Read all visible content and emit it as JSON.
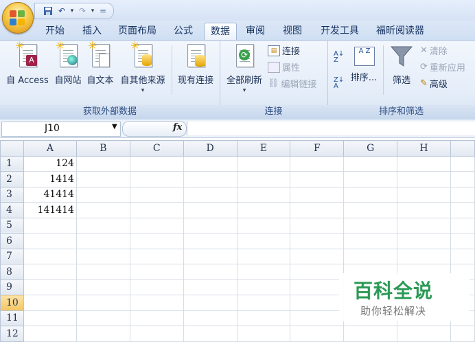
{
  "quick_access": {
    "save": "save-icon",
    "undo": "undo-icon",
    "redo": "redo-icon",
    "customize": "="
  },
  "tabs": [
    {
      "label": "开始"
    },
    {
      "label": "插入"
    },
    {
      "label": "页面布局"
    },
    {
      "label": "公式"
    },
    {
      "label": "数据",
      "active": true
    },
    {
      "label": "审阅"
    },
    {
      "label": "视图"
    },
    {
      "label": "开发工具"
    },
    {
      "label": "福昕阅读器"
    }
  ],
  "ribbon": {
    "external": {
      "label": "获取外部数据",
      "access": "自 Access",
      "web": "自网站",
      "text": "自文本",
      "other": "自其他来源",
      "existing": "现有连接"
    },
    "connections": {
      "label": "连接",
      "refresh_all": "全部刷新",
      "connections": "连接",
      "properties": "属性",
      "edit_links": "编辑链接"
    },
    "sort_filter": {
      "label": "排序和筛选",
      "sort": "排序...",
      "filter": "筛选",
      "clear": "清除",
      "reapply": "重新应用",
      "advanced": "高级",
      "az": "A Z",
      "za": "Z A"
    }
  },
  "formula_bar": {
    "name_box": "J10",
    "fx": "fx",
    "formula": ""
  },
  "sheet": {
    "columns": [
      "A",
      "B",
      "C",
      "D",
      "E",
      "F",
      "G",
      "H"
    ],
    "rows": [
      {
        "num": "1",
        "a": "124"
      },
      {
        "num": "2",
        "a": "1414"
      },
      {
        "num": "3",
        "a": "41414"
      },
      {
        "num": "4",
        "a": "141414"
      },
      {
        "num": "5",
        "a": ""
      },
      {
        "num": "6",
        "a": ""
      },
      {
        "num": "7",
        "a": ""
      },
      {
        "num": "8",
        "a": ""
      },
      {
        "num": "9",
        "a": ""
      },
      {
        "num": "10",
        "a": ""
      },
      {
        "num": "11",
        "a": ""
      },
      {
        "num": "12",
        "a": ""
      }
    ],
    "selected_row": "10"
  },
  "watermark": {
    "title": "百科全说",
    "subtitle": "助你轻松解决"
  }
}
